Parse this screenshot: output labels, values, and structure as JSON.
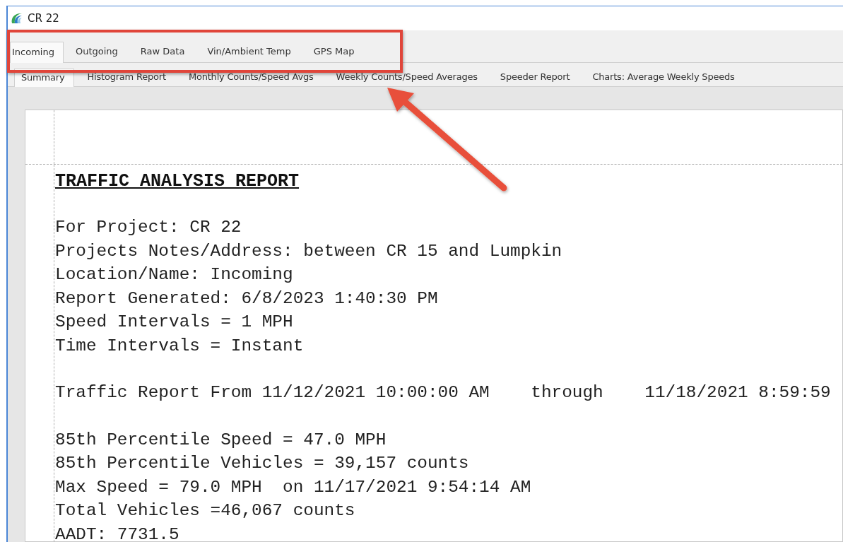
{
  "window": {
    "title": "CR 22"
  },
  "tabs": [
    {
      "label": "Incoming",
      "selected": true
    },
    {
      "label": "Outgoing",
      "selected": false
    },
    {
      "label": "Raw Data",
      "selected": false
    },
    {
      "label": "Vin/Ambient Temp",
      "selected": false
    },
    {
      "label": "GPS Map",
      "selected": false
    }
  ],
  "subtabs": [
    {
      "label": "Summary",
      "selected": true
    },
    {
      "label": "Histogram Report",
      "selected": false
    },
    {
      "label": "Monthly Counts/Speed Avgs",
      "selected": false
    },
    {
      "label": "Weekly Counts/Speed Averages",
      "selected": false
    },
    {
      "label": "Speeder Report",
      "selected": false
    },
    {
      "label": "Charts: Average Weekly Speeds",
      "selected": false
    }
  ],
  "report": {
    "title": "TRAFFIC ANALYSIS REPORT",
    "sections": [
      [
        "For Project: CR 22",
        "Projects Notes/Address: between CR 15 and Lumpkin",
        "Location/Name: Incoming",
        "Report Generated: 6/8/2023 1:40:30 PM",
        "Speed Intervals = 1 MPH",
        "Time Intervals = Instant"
      ],
      [
        "Traffic Report From 11/12/2021 10:00:00 AM    through    11/18/2021 8:59:59"
      ],
      [
        "85th Percentile Speed = 47.0 MPH",
        "85th Percentile Vehicles = 39,157 counts",
        "Max Speed = 79.0 MPH  on 11/17/2021 9:54:14 AM",
        "Total Vehicles =46,067 counts",
        "AADT: 7731.5"
      ]
    ]
  }
}
